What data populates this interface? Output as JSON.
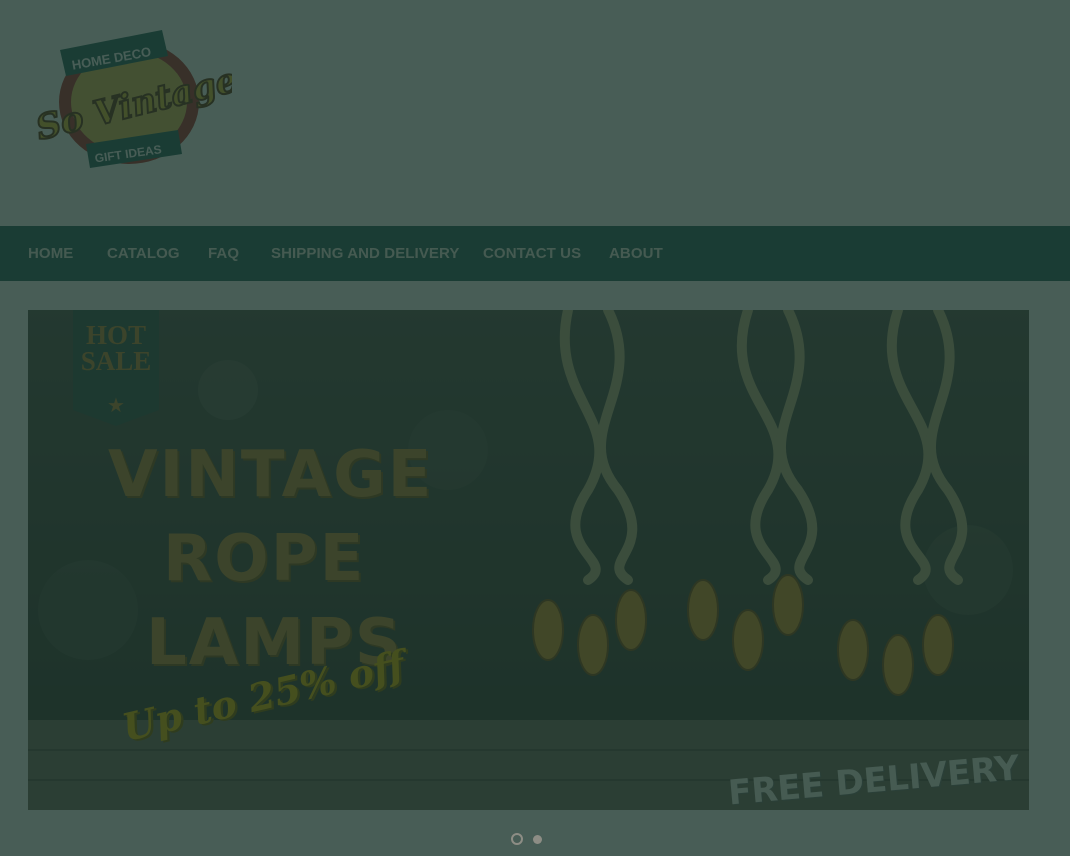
{
  "logo": {
    "top_ribbon": "HOME DECO",
    "script_name": "So Vintage",
    "bottom_ribbon": "GIFT IDEAS"
  },
  "nav": {
    "items": [
      {
        "label": "HOME"
      },
      {
        "label": "CATALOG"
      },
      {
        "label": "FAQ"
      },
      {
        "label": "SHIPPING AND DELIVERY"
      },
      {
        "label": "CONTACT US"
      },
      {
        "label": "ABOUT"
      }
    ]
  },
  "slider": {
    "badge_line1": "HOT",
    "badge_line2": "SALE",
    "headline_1": "VINTAGE",
    "headline_2": "ROPE",
    "headline_3": "LAMPS",
    "promo": "Up to 25% off",
    "delivery": "FREE DELIVERY",
    "slide_count": 2,
    "active_slide": 1
  },
  "colors": {
    "nav_bg": "#2f6b66",
    "headline": "#c88f3c",
    "promo": "#f2c000",
    "overlay": "rgba(20,48,38,0.78)"
  }
}
